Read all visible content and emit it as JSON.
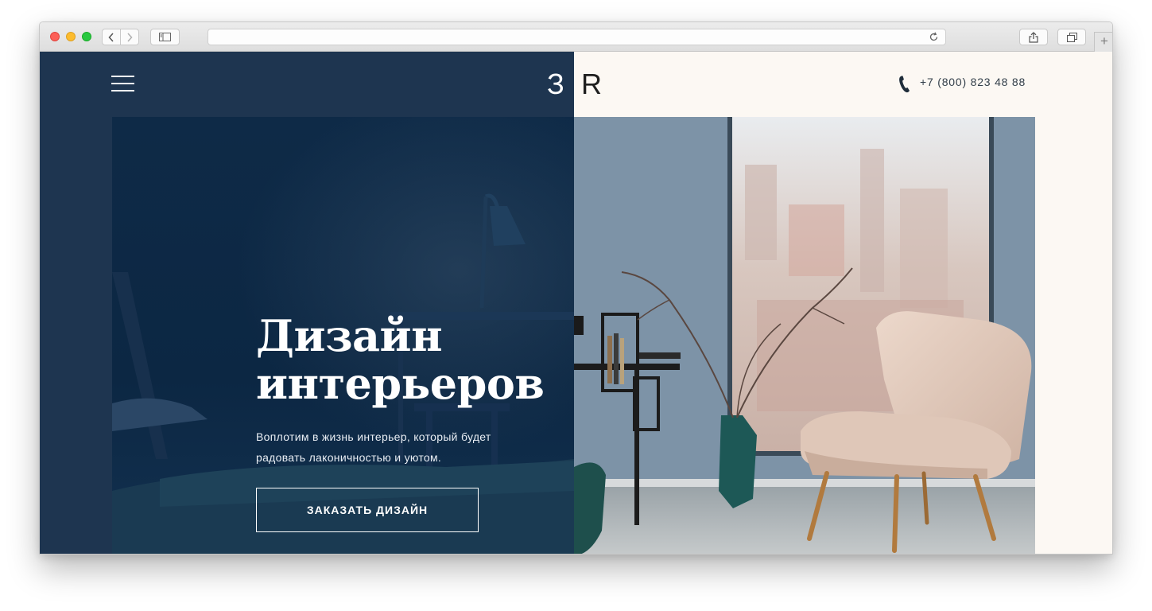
{
  "browser": {
    "address": "",
    "new_tab": "+"
  },
  "site": {
    "logo_left": "З",
    "logo_right": "R",
    "phone": "+7 (800) 823 48 88"
  },
  "hero": {
    "title_line1": "Дизайн",
    "title_line2": "интерьеров",
    "subtitle_line1": "Воплотим в жизнь интерьер, который будет",
    "subtitle_line2": "радовать лаконичностью и уютом.",
    "cta_label": "ЗАКАЗАТЬ ДИЗАЙН"
  },
  "colors": {
    "dark_navy": "#1e3550",
    "cream": "#fcf8f3",
    "hero_overlay": "#0e2a47"
  },
  "icons": [
    "menu-icon",
    "phone-icon",
    "back-icon",
    "forward-icon",
    "sidebar-icon",
    "reload-icon",
    "share-icon",
    "tabs-icon"
  ]
}
